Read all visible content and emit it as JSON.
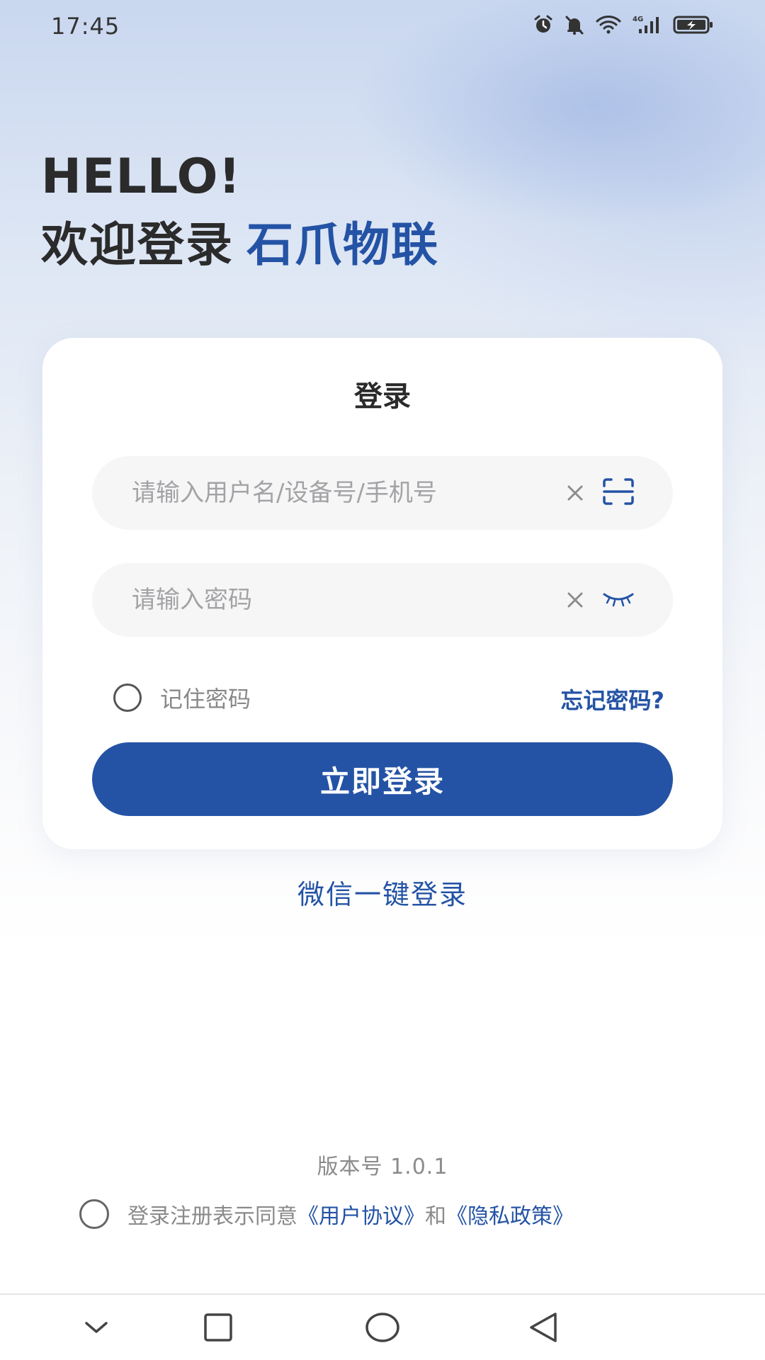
{
  "status_bar": {
    "time": "17:45",
    "icons": [
      "alarm-icon",
      "mute-bell-icon",
      "wifi-icon",
      "signal-4g-icon",
      "battery-charging-icon"
    ],
    "network_label": "4G"
  },
  "greeting": {
    "hello": "HELLO!",
    "welcome": "欢迎登录",
    "brand": "石爪物联"
  },
  "login_card": {
    "title": "登录",
    "username_placeholder": "请输入用户名/设备号/手机号",
    "username_value": "",
    "password_placeholder": "请输入密码",
    "password_value": "",
    "remember_label": "记住密码",
    "remember_checked": false,
    "forgot_label": "忘记密码?",
    "submit_label": "立即登录"
  },
  "wechat_login": "微信一键登录",
  "version": "版本号 1.0.1",
  "agreement": {
    "checked": false,
    "prefix": "登录注册表示同意",
    "user_agreement": "《用户协议》",
    "and": "和",
    "privacy_policy": "《隐私政策》"
  },
  "nav_bar": {
    "buttons": [
      "collapse-icon",
      "recents-icon",
      "home-icon",
      "back-icon"
    ]
  },
  "colors": {
    "accent": "#2453a5",
    "text_primary": "#2b2b2b",
    "placeholder": "#a3a3a6",
    "field_bg": "#f6f6f7"
  }
}
